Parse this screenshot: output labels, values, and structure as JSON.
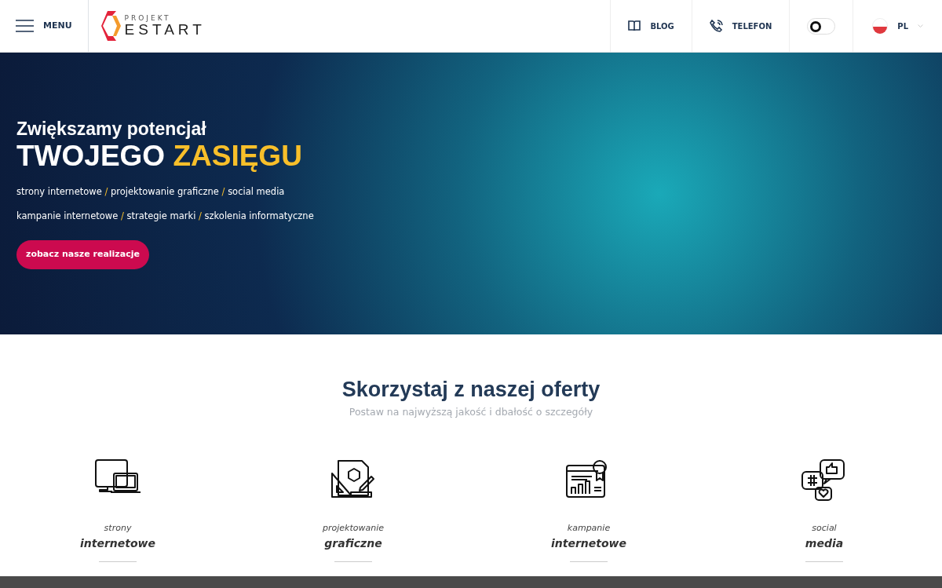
{
  "header": {
    "menu_label": "MENU",
    "logo": {
      "top": "PROJEKT",
      "bottom": "ESTART"
    },
    "nav": [
      {
        "kind": "book",
        "label": "BLOG"
      },
      {
        "kind": "phone",
        "label": "TELEFON"
      }
    ],
    "theme_toggle": {
      "on": false
    },
    "language": {
      "label": "PL"
    }
  },
  "hero": {
    "title_line1": "Zwiększamy potencjał",
    "title_line2": [
      {
        "text": "TWOJEGO",
        "highlight": false
      },
      {
        "text": "ZASIĘGU",
        "highlight": true
      }
    ],
    "separator": "/",
    "service_lines": [
      [
        "strony internetowe",
        "projektowanie graficzne",
        "social media"
      ],
      [
        "kampanie internetowe",
        "strategie marki",
        "szkolenia informatyczne"
      ]
    ],
    "button": "zobacz nasze realizacje"
  },
  "offer": {
    "title": "Skorzystaj z naszej oferty",
    "subtitle": "Postaw na najwyższą jakość i dbałość o szczegóły",
    "items": [
      {
        "kind": "devices",
        "top": "strony",
        "bottom": "internetowe"
      },
      {
        "kind": "design",
        "top": "projektowanie",
        "bottom": "graficzne"
      },
      {
        "kind": "campaign",
        "top": "kampanie",
        "bottom": "internetowe"
      },
      {
        "kind": "social",
        "top": "social",
        "bottom": "media"
      }
    ]
  }
}
